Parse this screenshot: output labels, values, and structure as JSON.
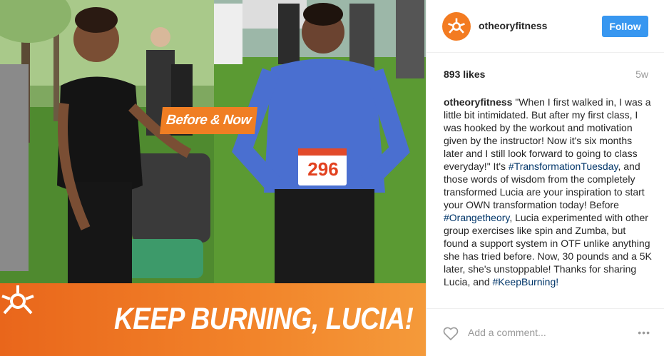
{
  "photo": {
    "tag_text": "Before & Now",
    "banner_text": "KEEP BURNING, LUCIA!",
    "bib_number": "296",
    "logo_icon": "orangetheory-logo-icon"
  },
  "post": {
    "username": "otheoryfitness",
    "follow_label": "Follow",
    "likes": "893 likes",
    "age": "5w",
    "caption_user": "otheoryfitness",
    "caption_part1": " \"When I first walked in, I was a little bit intimidated. But after my first class, I was hooked by the workout and motivation given by the instructor! Now it's six months later and I still look forward to going to class everyday!\" It's ",
    "hashtag1": "#TransformationTuesday",
    "caption_part2": ", and those words of wisdom from the completely transformed Lucia are your inspiration to start your OWN transformation today! Before ",
    "hashtag2": "#Orangetheory",
    "caption_part3": ", Lucia experimented with other group exercises like spin and Zumba, but found a support system in OTF unlike anything she has tried before. Now, 30 pounds and a 5K later, she's unstoppable! Thanks for sharing Lucia, and ",
    "hashtag3": "#KeepBurning!",
    "comment_placeholder": "Add a comment...",
    "more_label": "•••"
  },
  "colors": {
    "accent": "#f37b21",
    "follow_blue": "#3897f0",
    "hashtag": "#003569"
  }
}
